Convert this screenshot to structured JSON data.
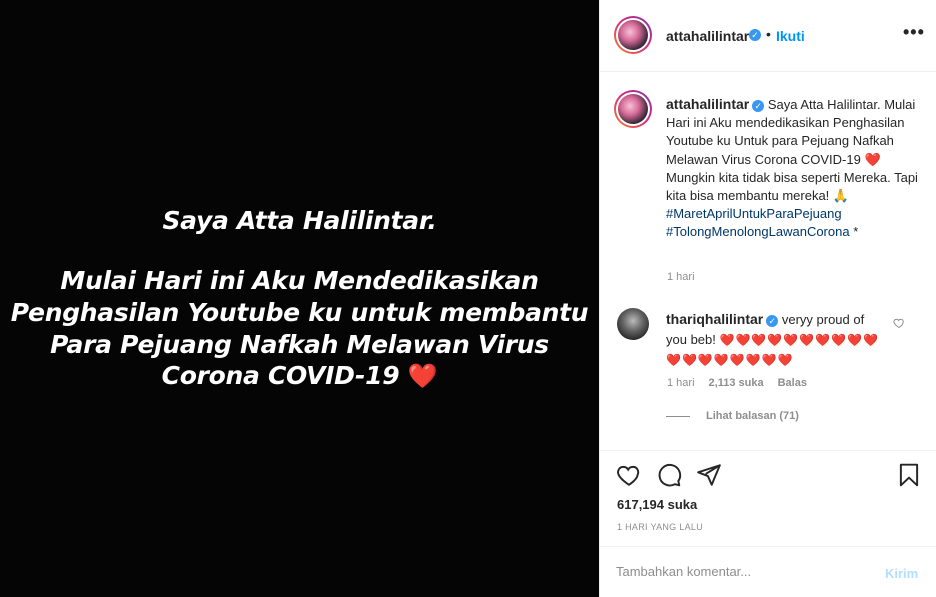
{
  "image": {
    "line1": "Saya Atta Halilintar.",
    "line2": "Mulai Hari ini Aku Mendedikasikan",
    "line3": "Penghasilan Youtube ku untuk membantu",
    "line4": "Para Pejuang Nafkah Melawan Virus",
    "line5": "Corona COVID-19",
    "heart": "❤️"
  },
  "header": {
    "username": "attahalilintar",
    "verified_mark": "✓",
    "dot": "•",
    "follow_label": "Ikuti",
    "more": "•••"
  },
  "caption": {
    "username": "attahalilintar",
    "verified_mark": "✓",
    "text_a": " Saya Atta Halilintar. Mulai Hari ini Aku mendedikasikan Penghasilan Youtube ku Untuk para Pejuang Nafkah Melawan Virus Corona COVID-19 ",
    "heart": "❤️",
    "text_b": " Mungkin kita tidak bisa seperti Mereka. Tapi kita bisa membantu mereka! ",
    "pray": "🙏",
    "hashtag1": "#MaretAprilUntukParaPejuang",
    "hashtag2": "#TolongMenolongLawanCorona",
    "tail": " *",
    "time": "1 hari"
  },
  "comment": {
    "username": "thariqhalilintar",
    "verified_mark": "✓",
    "text": " veryy proud of you beb!",
    "hearts": "❤️❤️❤️❤️❤️❤️❤️❤️❤️❤️❤️❤️❤️❤️❤️❤️❤️❤️",
    "time": "1 hari",
    "likes": "2,113 suka",
    "reply": "Balas",
    "view_replies": "Lihat balasan (71)"
  },
  "actions": {
    "likes": "617,194 suka",
    "time_ago": "1 HARI YANG LALU"
  },
  "add_comment": {
    "placeholder": "Tambahkan komentar...",
    "post_label": "Kirim"
  }
}
